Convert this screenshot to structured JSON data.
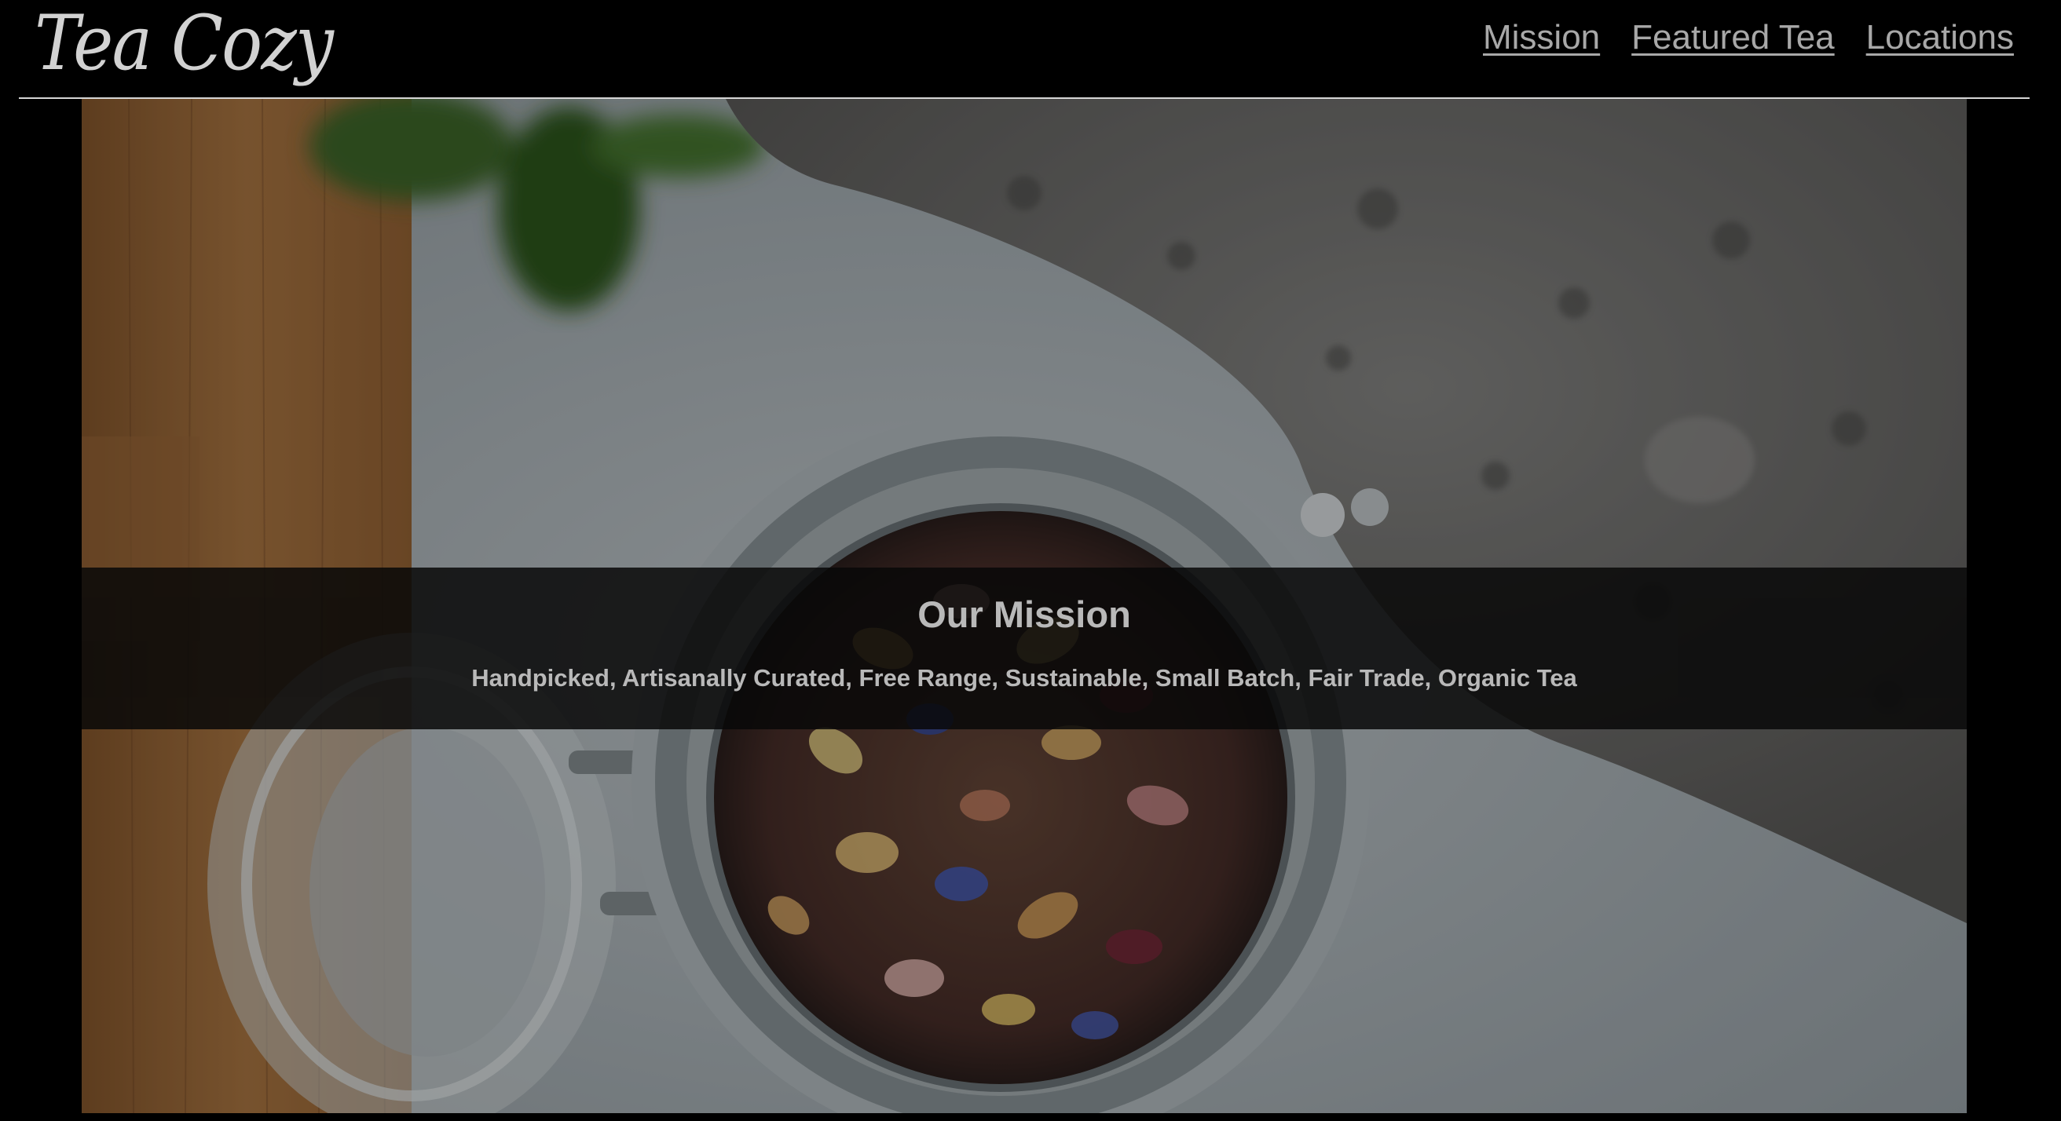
{
  "header": {
    "logo": "Tea Cozy",
    "nav": [
      {
        "label": "Mission"
      },
      {
        "label": "Featured Tea"
      },
      {
        "label": "Locations"
      }
    ]
  },
  "hero": {
    "title": "Our Mission",
    "subtitle": "Handpicked, Artisanally Curated, Free Range, Sustainable, Small Batch, Fair Trade, Organic Tea"
  }
}
